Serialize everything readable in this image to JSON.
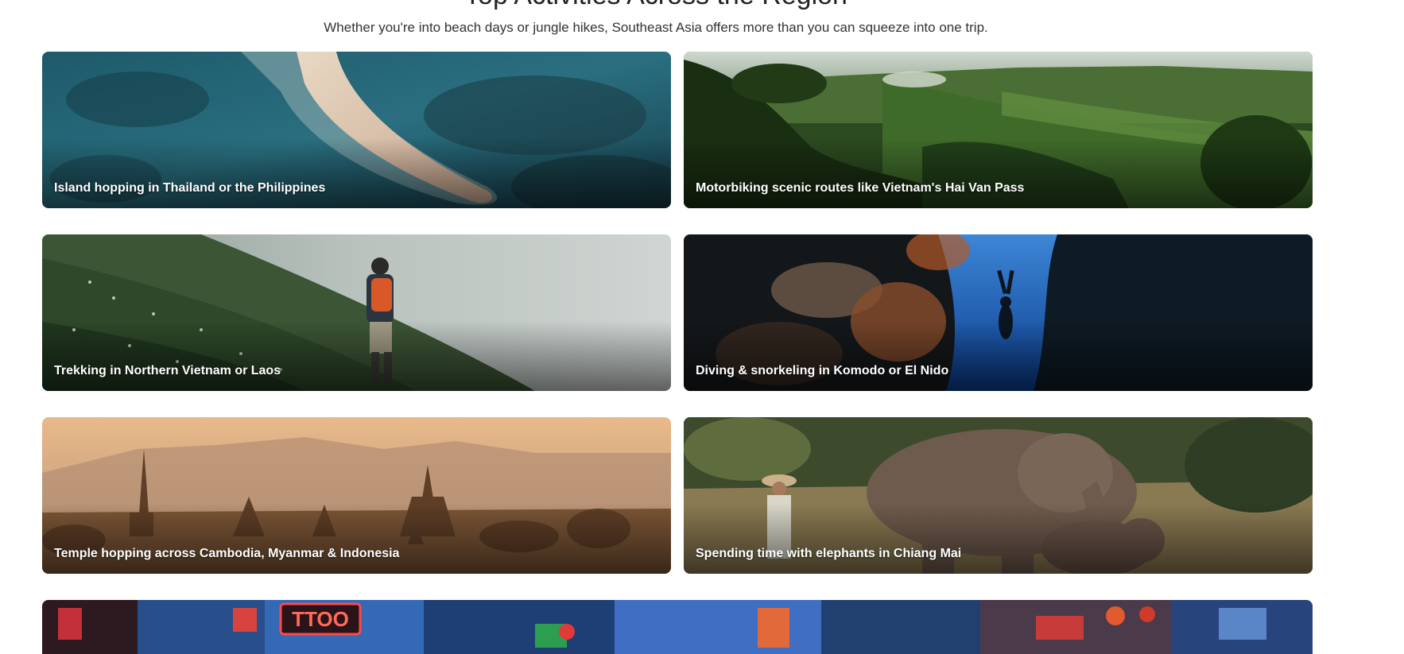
{
  "section": {
    "title": "Top Activities Across the Region",
    "subtitle": "Whether you're into beach days or jungle hikes, Southeast Asia offers more than you can squeeze into one trip."
  },
  "activities": [
    {
      "label": "Island hopping in Thailand or the Philippines"
    },
    {
      "label": "Motorbiking scenic routes like Vietnam's Hai Van Pass"
    },
    {
      "label": "Trekking in Northern Vietnam or Laos"
    },
    {
      "label": "Diving & snorkeling in Komodo or El Nido"
    },
    {
      "label": "Temple hopping across Cambodia, Myanmar & Indonesia"
    },
    {
      "label": "Spending time with elephants in Chiang Mai"
    },
    {
      "label": ""
    }
  ],
  "sign_text": "TTOO"
}
